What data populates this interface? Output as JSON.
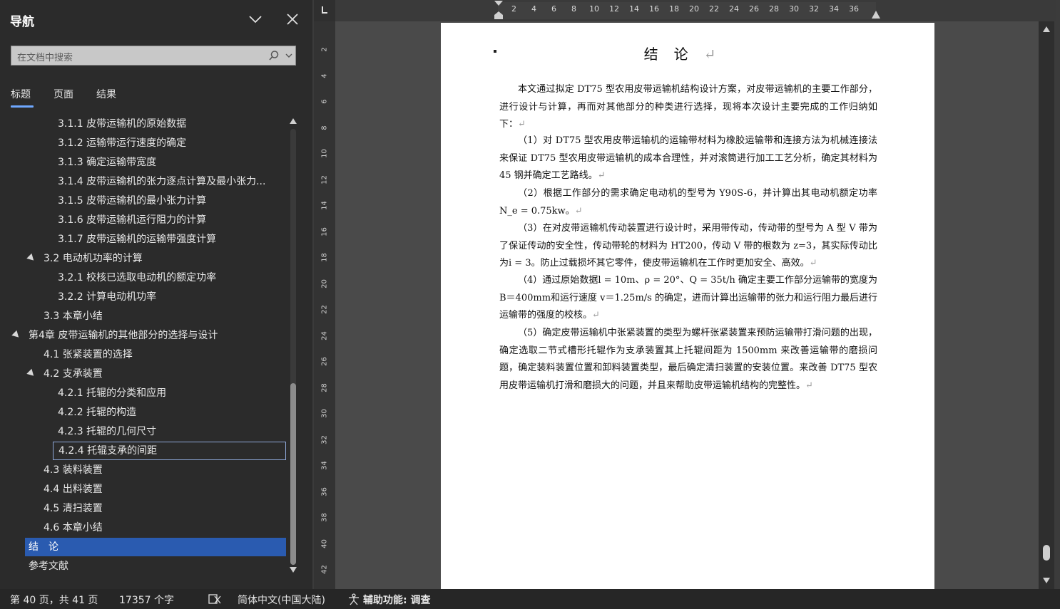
{
  "nav": {
    "title": "导航",
    "search_placeholder": "在文档中搜索",
    "tabs": [
      "标题",
      "页面",
      "结果"
    ],
    "active_tab": "标题",
    "items": [
      {
        "label": "3.1.1 皮带运输机的原始数据",
        "level": 3
      },
      {
        "label": "3.1.2 运输带运行速度的确定",
        "level": 3
      },
      {
        "label": "3.1.3 确定运输带宽度",
        "level": 3
      },
      {
        "label": "3.1.4 皮带运输机的张力逐点计算及最小张力...",
        "level": 3
      },
      {
        "label": "3.1.5 皮带运输机的最小张力计算",
        "level": 3
      },
      {
        "label": "3.1.6 皮带运输机运行阻力的计算",
        "level": 3
      },
      {
        "label": "3.1.7 皮带运输机的运输带强度计算",
        "level": 3
      },
      {
        "label": "3.2 电动机功率的计算",
        "level": 2,
        "expanded": true
      },
      {
        "label": "3.2.1 校核已选取电动机的额定功率",
        "level": 3
      },
      {
        "label": "3.2.2 计算电动机功率",
        "level": 3
      },
      {
        "label": "3.3 本章小结",
        "level": 2
      },
      {
        "label": "第4章 皮带运输机的其他部分的选择与设计",
        "level": 1,
        "expanded": true
      },
      {
        "label": "4.1 张紧装置的选择",
        "level": 2
      },
      {
        "label": "4.2 支承装置",
        "level": 2,
        "expanded": true
      },
      {
        "label": "4.2.1 托辊的分类和应用",
        "level": 3
      },
      {
        "label": "4.2.2 托辊的构造",
        "level": 3
      },
      {
        "label": "4.2.3 托辊的几何尺寸",
        "level": 3
      },
      {
        "label": "4.2.4 托辊支承的间距",
        "level": 3,
        "focused": true
      },
      {
        "label": "4.3 装料装置",
        "level": 2
      },
      {
        "label": "4.4 出料装置",
        "level": 2
      },
      {
        "label": "4.5 清扫装置",
        "level": 2
      },
      {
        "label": "4.6 本章小结",
        "level": 2
      },
      {
        "label": "结　论",
        "level": 1,
        "selected": true
      },
      {
        "label": "参考文献",
        "level": 1
      }
    ]
  },
  "ruler": {
    "marks": [
      "2",
      "4",
      "6",
      "8",
      "10",
      "12",
      "14",
      "16",
      "18",
      "20",
      "22",
      "24",
      "26",
      "28",
      "30",
      "32",
      "34",
      "36"
    ],
    "vmarks": [
      "2",
      "4",
      "6",
      "8",
      "10",
      "12",
      "14",
      "16",
      "18",
      "20",
      "22",
      "24",
      "26",
      "28",
      "30",
      "32",
      "34",
      "36",
      "38",
      "40",
      "42"
    ]
  },
  "document": {
    "title": "结论",
    "paragraphs": [
      "本文通过拟定 DT75 型农用皮带运输机结构设计方案，对皮带运输机的主要工作部分，进行设计与计算，再而对其他部分的种类进行选择，现将本次设计主要完成的工作归纳如下：",
      "（1）对 DT75 型农用皮带运输机的运输带材料为橡胶运输带和连接方法为机械连接法来保证 DT75 型农用皮带运输机的成本合理性，并对滚筒进行加工工艺分析，确定其材料为 45 钢并确定工艺路线。",
      "（2）根据工作部分的需求确定电动机的型号为 Y90S-6，并计算出其电动机额定功率N_e = 0.75kw。",
      "（3）在对皮带运输机传动装置进行设计时，采用带传动，传动带的型号为 A 型 V 带为了保证传动的安全性，传动带轮的材料为 HT200，传动 V 带的根数为 z=3，其实际传动比为i = 3。防止过载损坏其它零件，使皮带运输机在工作时更加安全、高效。",
      "（4）通过原始数据l = 10m、ρ = 20°、Q = 35t/h 确定主要工作部分运输带的宽度为 B＝400mm和运行速度 v＝1.25m/s 的确定，进而计算出运输带的张力和运行阻力最后进行运输带的强度的校核。",
      "（5）确定皮带运输机中张紧装置的类型为螺杆张紧装置来预防运输带打滑问题的出现，确定选取二节式槽形托辊作为支承装置其上托辊间距为 1500mm 来改善运输带的磨损问题，确定装料装置位置和卸料装置类型，最后确定清扫装置的安装位置。来改善 DT75 型农用皮带运输机打滑和磨损大的问题，并且来帮助皮带运输机结构的完整性。"
    ],
    "para_mark": "↵"
  },
  "status": {
    "page": "第 40 页，共 41 页",
    "words": "17357 个字",
    "language": "简体中文(中国大陆)",
    "accessibility": "辅助功能: 调查"
  },
  "colors": {
    "selected": "#2a5bb0",
    "accent": "#6fa8ff"
  }
}
